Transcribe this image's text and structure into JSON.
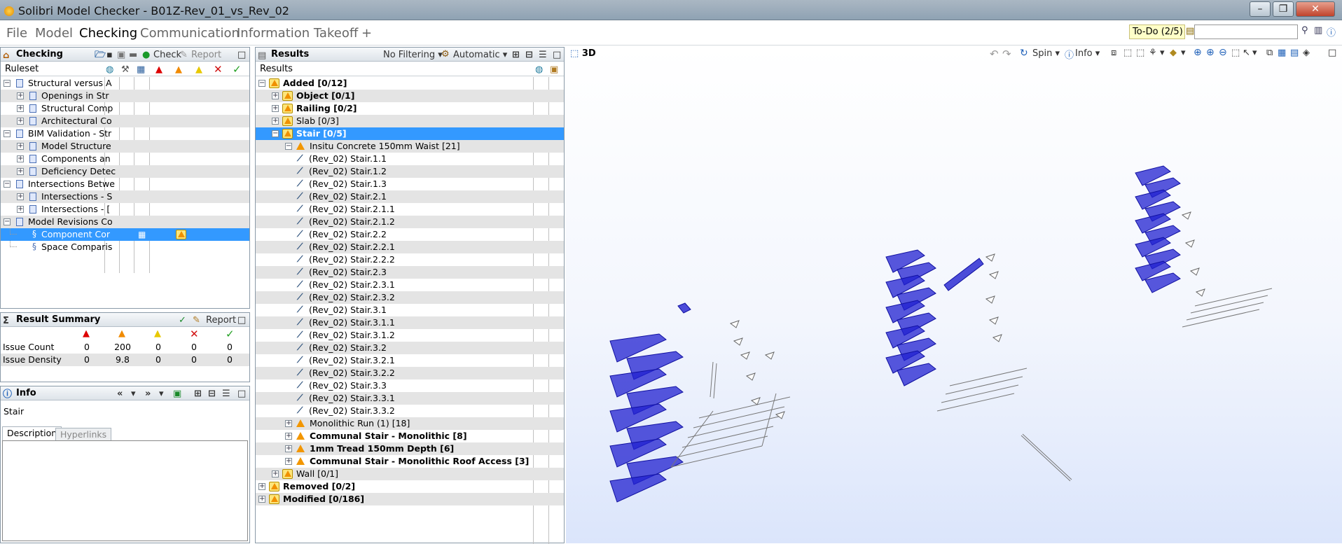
{
  "window": {
    "title": "Solibri Model Checker - B01Z-Rev_01_vs_Rev_02",
    "controls": [
      "–",
      "❐",
      "✕"
    ]
  },
  "menu": {
    "items": [
      {
        "label": "File",
        "active": false
      },
      {
        "label": "Model",
        "active": false
      },
      {
        "label": "Checking",
        "active": true
      },
      {
        "label": "Communication",
        "active": false
      },
      {
        "label": "Information Takeoff",
        "active": false
      },
      {
        "label": "+",
        "active": false
      }
    ]
  },
  "todo": {
    "label": "To-Do (2/5)",
    "search_value": ""
  },
  "checking": {
    "title": "Checking",
    "check_label": "Check",
    "report_label": "Report",
    "column_header": "Ruleset",
    "rows": [
      {
        "label": "Structural versus A",
        "level": 0,
        "toggle": "−",
        "icon": "book",
        "alt": false,
        "sel": false
      },
      {
        "label": "Openings in Str",
        "level": 1,
        "toggle": "+",
        "icon": "book",
        "alt": true,
        "sel": false
      },
      {
        "label": "Structural Comp",
        "level": 1,
        "toggle": "+",
        "icon": "book",
        "alt": false,
        "sel": false
      },
      {
        "label": "Architectural Co",
        "level": 1,
        "toggle": "+",
        "icon": "book",
        "alt": true,
        "sel": false
      },
      {
        "label": "BIM Validation - Str",
        "level": 0,
        "toggle": "−",
        "icon": "book",
        "alt": false,
        "sel": false
      },
      {
        "label": "Model Structure",
        "level": 1,
        "toggle": "+",
        "icon": "book",
        "alt": true,
        "sel": false
      },
      {
        "label": "Components an",
        "level": 1,
        "toggle": "+",
        "icon": "book",
        "alt": false,
        "sel": false
      },
      {
        "label": "Deficiency Detec",
        "level": 1,
        "toggle": "+",
        "icon": "book",
        "alt": true,
        "sel": false
      },
      {
        "label": "Intersections Betwe",
        "level": 0,
        "toggle": "−",
        "icon": "book",
        "alt": false,
        "sel": false
      },
      {
        "label": "Intersections - S",
        "level": 1,
        "toggle": "+",
        "icon": "book",
        "alt": true,
        "sel": false
      },
      {
        "label": "Intersections - [",
        "level": 1,
        "toggle": "+",
        "icon": "book",
        "alt": false,
        "sel": false
      },
      {
        "label": "Model Revisions Co",
        "level": 0,
        "toggle": "−",
        "icon": "book",
        "alt": true,
        "sel": false
      },
      {
        "label": "Component Cor",
        "level": 1,
        "toggle": "",
        "icon": "rule",
        "alt": false,
        "sel": true
      },
      {
        "label": "Space Comparis",
        "level": 1,
        "toggle": "",
        "icon": "rule",
        "alt": false,
        "sel": false
      }
    ]
  },
  "summary": {
    "title": "Result Summary",
    "report_label": "Report",
    "rows": [
      {
        "label": "Issue Count",
        "values": [
          "0",
          "200",
          "0",
          "0",
          "0"
        ]
      },
      {
        "label": "Issue Density",
        "values": [
          "0",
          "9.8",
          "0",
          "0",
          "0"
        ]
      }
    ]
  },
  "info": {
    "title": "Info",
    "selected": "Stair",
    "tabs": [
      "Description",
      "Hyperlinks"
    ]
  },
  "results": {
    "title": "Results",
    "filter_label": "No Filtering",
    "mode_label": "Automatic",
    "column_header": "Results",
    "rows": [
      {
        "label": "Added [0/12]",
        "level": 0,
        "toggle": "−",
        "icon": "warnbox",
        "bold": true,
        "alt": false,
        "sel": false
      },
      {
        "label": "Object [0/1]",
        "level": 1,
        "toggle": "+",
        "icon": "warnbox",
        "bold": true,
        "alt": true,
        "sel": false
      },
      {
        "label": "Railing [0/2]",
        "level": 1,
        "toggle": "+",
        "icon": "warnbox",
        "bold": true,
        "alt": false,
        "sel": false
      },
      {
        "label": "Slab [0/3]",
        "level": 1,
        "toggle": "+",
        "icon": "warnbox",
        "bold": false,
        "alt": true,
        "sel": false
      },
      {
        "label": "Stair [0/5]",
        "level": 1,
        "toggle": "−",
        "icon": "warnbox",
        "bold": true,
        "alt": false,
        "sel": true
      },
      {
        "label": "Insitu Concrete 150mm Waist [21]",
        "level": 2,
        "toggle": "−",
        "icon": "warn",
        "bold": false,
        "alt": true,
        "sel": false
      },
      {
        "label": "(Rev_02) Stair.1.1",
        "level": 3,
        "toggle": "",
        "icon": "stair",
        "bold": false,
        "alt": false,
        "sel": false
      },
      {
        "label": "(Rev_02) Stair.1.2",
        "level": 3,
        "toggle": "",
        "icon": "stair",
        "bold": false,
        "alt": true,
        "sel": false
      },
      {
        "label": "(Rev_02) Stair.1.3",
        "level": 3,
        "toggle": "",
        "icon": "stair",
        "bold": false,
        "alt": false,
        "sel": false
      },
      {
        "label": "(Rev_02) Stair.2.1",
        "level": 3,
        "toggle": "",
        "icon": "stair",
        "bold": false,
        "alt": true,
        "sel": false
      },
      {
        "label": "(Rev_02) Stair.2.1.1",
        "level": 3,
        "toggle": "",
        "icon": "stair",
        "bold": false,
        "alt": false,
        "sel": false
      },
      {
        "label": "(Rev_02) Stair.2.1.2",
        "level": 3,
        "toggle": "",
        "icon": "stair",
        "bold": false,
        "alt": true,
        "sel": false
      },
      {
        "label": "(Rev_02) Stair.2.2",
        "level": 3,
        "toggle": "",
        "icon": "stair",
        "bold": false,
        "alt": false,
        "sel": false
      },
      {
        "label": "(Rev_02) Stair.2.2.1",
        "level": 3,
        "toggle": "",
        "icon": "stair",
        "bold": false,
        "alt": true,
        "sel": false
      },
      {
        "label": "(Rev_02) Stair.2.2.2",
        "level": 3,
        "toggle": "",
        "icon": "stair",
        "bold": false,
        "alt": false,
        "sel": false
      },
      {
        "label": "(Rev_02) Stair.2.3",
        "level": 3,
        "toggle": "",
        "icon": "stair",
        "bold": false,
        "alt": true,
        "sel": false
      },
      {
        "label": "(Rev_02) Stair.2.3.1",
        "level": 3,
        "toggle": "",
        "icon": "stair",
        "bold": false,
        "alt": false,
        "sel": false
      },
      {
        "label": "(Rev_02) Stair.2.3.2",
        "level": 3,
        "toggle": "",
        "icon": "stair",
        "bold": false,
        "alt": true,
        "sel": false
      },
      {
        "label": "(Rev_02) Stair.3.1",
        "level": 3,
        "toggle": "",
        "icon": "stair",
        "bold": false,
        "alt": false,
        "sel": false
      },
      {
        "label": "(Rev_02) Stair.3.1.1",
        "level": 3,
        "toggle": "",
        "icon": "stair",
        "bold": false,
        "alt": true,
        "sel": false
      },
      {
        "label": "(Rev_02) Stair.3.1.2",
        "level": 3,
        "toggle": "",
        "icon": "stair",
        "bold": false,
        "alt": false,
        "sel": false
      },
      {
        "label": "(Rev_02) Stair.3.2",
        "level": 3,
        "toggle": "",
        "icon": "stair",
        "bold": false,
        "alt": true,
        "sel": false
      },
      {
        "label": "(Rev_02) Stair.3.2.1",
        "level": 3,
        "toggle": "",
        "icon": "stair",
        "bold": false,
        "alt": false,
        "sel": false
      },
      {
        "label": "(Rev_02) Stair.3.2.2",
        "level": 3,
        "toggle": "",
        "icon": "stair",
        "bold": false,
        "alt": true,
        "sel": false
      },
      {
        "label": "(Rev_02) Stair.3.3",
        "level": 3,
        "toggle": "",
        "icon": "stair",
        "bold": false,
        "alt": false,
        "sel": false
      },
      {
        "label": "(Rev_02) Stair.3.3.1",
        "level": 3,
        "toggle": "",
        "icon": "stair",
        "bold": false,
        "alt": true,
        "sel": false
      },
      {
        "label": "(Rev_02) Stair.3.3.2",
        "level": 3,
        "toggle": "",
        "icon": "stair",
        "bold": false,
        "alt": false,
        "sel": false
      },
      {
        "label": "Monolithic Run (1) [18]",
        "level": 2,
        "toggle": "+",
        "icon": "warn",
        "bold": false,
        "alt": true,
        "sel": false
      },
      {
        "label": "Communal Stair - Monolithic [8]",
        "level": 2,
        "toggle": "+",
        "icon": "warn",
        "bold": true,
        "alt": false,
        "sel": false
      },
      {
        "label": "1mm Tread 150mm Depth [6]",
        "level": 2,
        "toggle": "+",
        "icon": "warn",
        "bold": true,
        "alt": true,
        "sel": false
      },
      {
        "label": "Communal Stair - Monolithic Roof Access [3]",
        "level": 2,
        "toggle": "+",
        "icon": "warn",
        "bold": true,
        "alt": false,
        "sel": false
      },
      {
        "label": "Wall [0/1]",
        "level": 1,
        "toggle": "+",
        "icon": "warnbox",
        "bold": false,
        "alt": true,
        "sel": false
      },
      {
        "label": "Removed [0/2]",
        "level": 0,
        "toggle": "+",
        "icon": "warnbox",
        "bold": true,
        "alt": false,
        "sel": false
      },
      {
        "label": "Modified [0/186]",
        "level": 0,
        "toggle": "+",
        "icon": "warnbox",
        "bold": true,
        "alt": true,
        "sel": false
      }
    ]
  },
  "view3d": {
    "title": "3D",
    "spin_label": "Spin",
    "info_label": "Info",
    "stair_color": "#2020d0"
  }
}
